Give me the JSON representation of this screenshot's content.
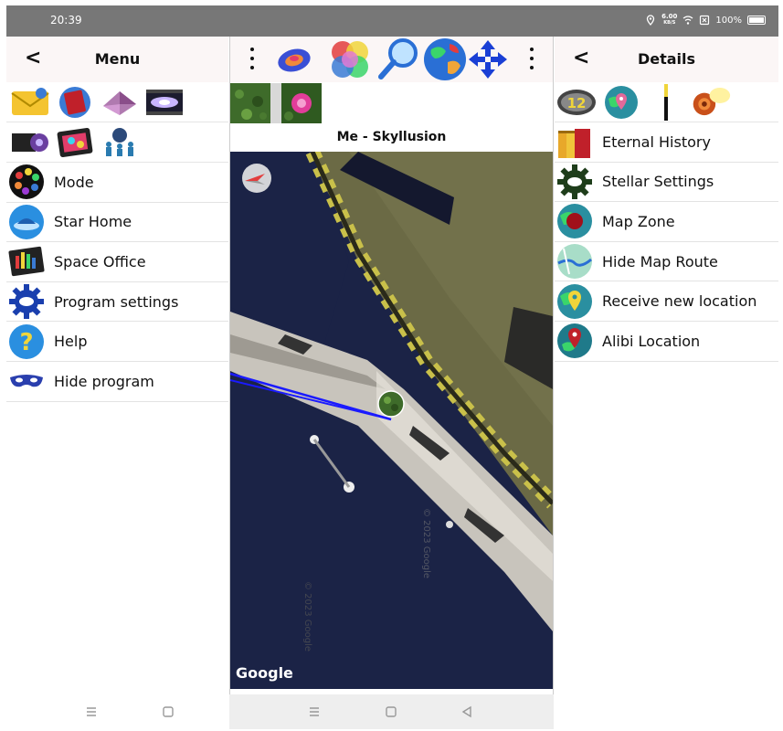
{
  "status": {
    "time": "20:39",
    "speed_value": "6.00",
    "speed_unit": "KB/S",
    "battery": "100%"
  },
  "left_panel": {
    "back_label": "<",
    "title": "Menu",
    "items": [
      {
        "label": "Mode",
        "icon": "palette-icon"
      },
      {
        "label": "Star Home",
        "icon": "star-home-icon"
      },
      {
        "label": "Space Office",
        "icon": "space-office-icon"
      },
      {
        "label": "Program settings",
        "icon": "gear-icon"
      },
      {
        "label": "Help",
        "icon": "help-icon"
      },
      {
        "label": "Hide program",
        "icon": "mask-icon"
      }
    ]
  },
  "middle_panel": {
    "subtitle": "Me  - Skyllusion",
    "map_watermark": "Google",
    "map_copyright": "© 2023 Google"
  },
  "right_panel": {
    "back_label": "<",
    "title": "Details",
    "items": [
      {
        "label": "Eternal History",
        "icon": "books-icon"
      },
      {
        "label": "Stellar Settings",
        "icon": "gear-icon"
      },
      {
        "label": "Map Zone",
        "icon": "map-zone-icon"
      },
      {
        "label": "Hide Map Route",
        "icon": "map-route-icon"
      },
      {
        "label": "Receive new location",
        "icon": "location-receive-icon"
      },
      {
        "label": "Alibi Location",
        "icon": "location-pin-icon"
      }
    ],
    "badge_number": "12"
  },
  "colors": {
    "header_bg": "#fbf6f6",
    "route": "#1a1aff",
    "gear": "#1a3fae",
    "status_bar": "#777777"
  }
}
